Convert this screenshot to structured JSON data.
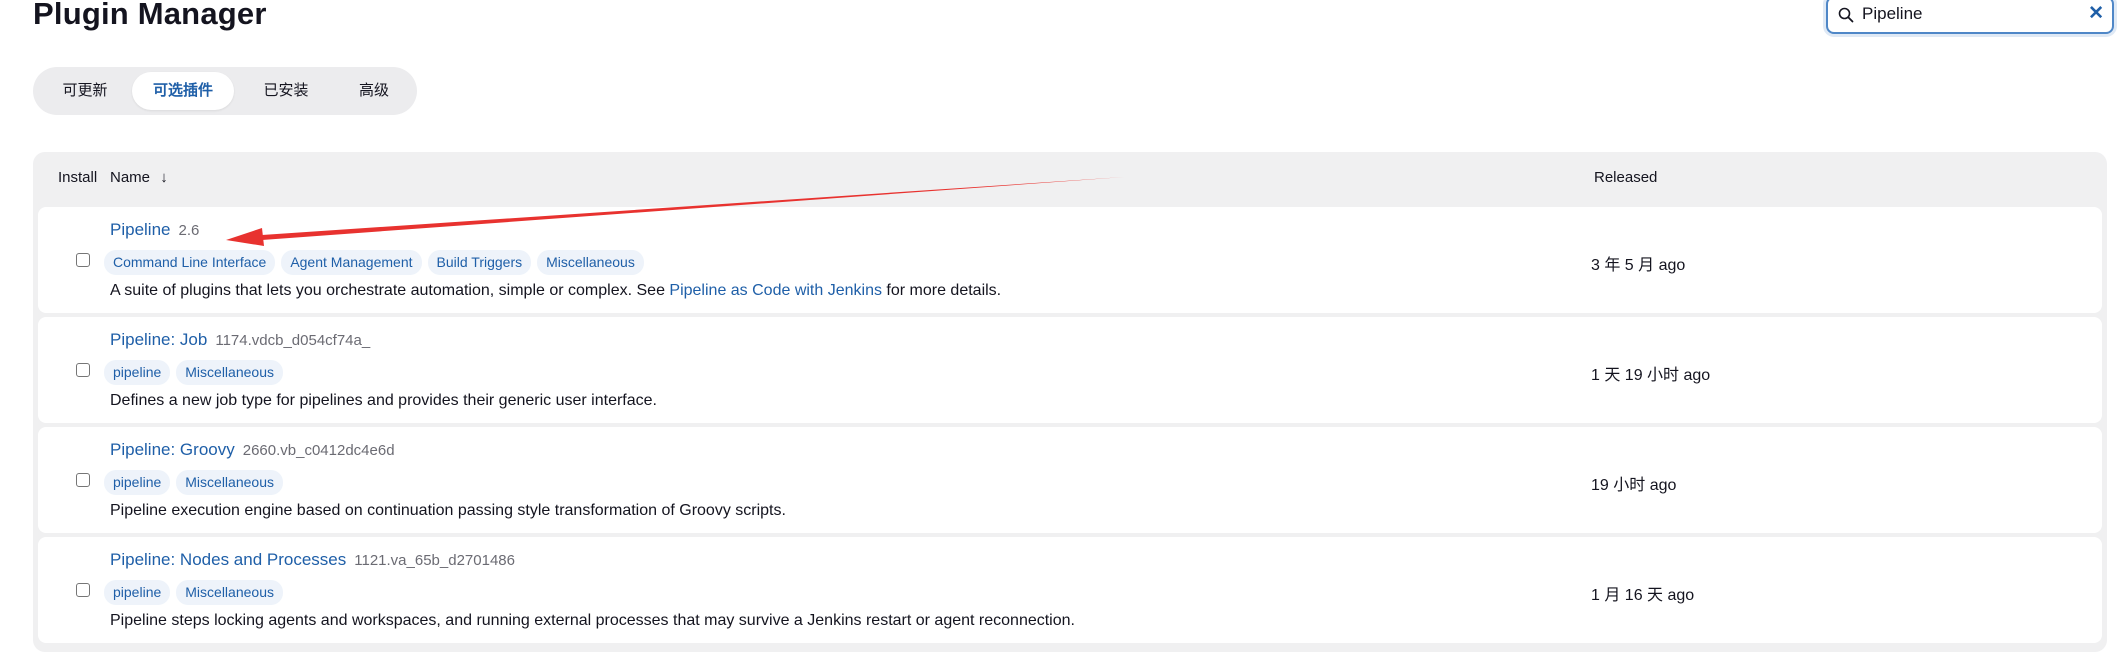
{
  "page": {
    "title": "Plugin Manager"
  },
  "search": {
    "value": "Pipeline",
    "clear_glyph": "✕"
  },
  "tabs": [
    {
      "label": "可更新",
      "active": false
    },
    {
      "label": "可选插件",
      "active": true
    },
    {
      "label": "已安装",
      "active": false
    },
    {
      "label": "高级",
      "active": false
    }
  ],
  "table": {
    "headers": {
      "install": "Install",
      "name": "Name",
      "sort_glyph": "↓",
      "released": "Released"
    },
    "rows": [
      {
        "name": "Pipeline",
        "version": "2.6",
        "tags": [
          "Command Line Interface",
          "Agent Management",
          "Build Triggers",
          "Miscellaneous"
        ],
        "desc_before": "A suite of plugins that lets you orchestrate automation, simple or complex. See ",
        "desc_link": "Pipeline as Code with Jenkins",
        "desc_after": " for more details.",
        "released": "3 年 5 月 ago"
      },
      {
        "name": "Pipeline: Job",
        "version": "1174.vdcb_d054cf74a_",
        "tags": [
          "pipeline",
          "Miscellaneous"
        ],
        "desc_before": "Defines a new job type for pipelines and provides their generic user interface.",
        "desc_link": "",
        "desc_after": "",
        "released": "1 天 19 小时 ago"
      },
      {
        "name": "Pipeline: Groovy",
        "version": "2660.vb_c0412dc4e6d",
        "tags": [
          "pipeline",
          "Miscellaneous"
        ],
        "desc_before": "Pipeline execution engine based on continuation passing style transformation of Groovy scripts.",
        "desc_link": "",
        "desc_after": "",
        "released": "19 小时 ago"
      },
      {
        "name": "Pipeline: Nodes and Processes",
        "version": "1121.va_65b_d2701486",
        "tags": [
          "pipeline",
          "Miscellaneous"
        ],
        "desc_before": "Pipeline steps locking agents and workspaces, and running external processes that may survive a Jenkins restart or agent reconnection.",
        "desc_link": "",
        "desc_after": "",
        "released": "1 月 16 天 ago"
      }
    ]
  },
  "colors": {
    "accent": "#1f5fa8",
    "annotation_arrow": "#e8322f",
    "tag_bg": "#eef3fa"
  },
  "icons": {
    "search": "search-icon",
    "clear": "close-icon",
    "annotation": "annotation-arrow"
  }
}
